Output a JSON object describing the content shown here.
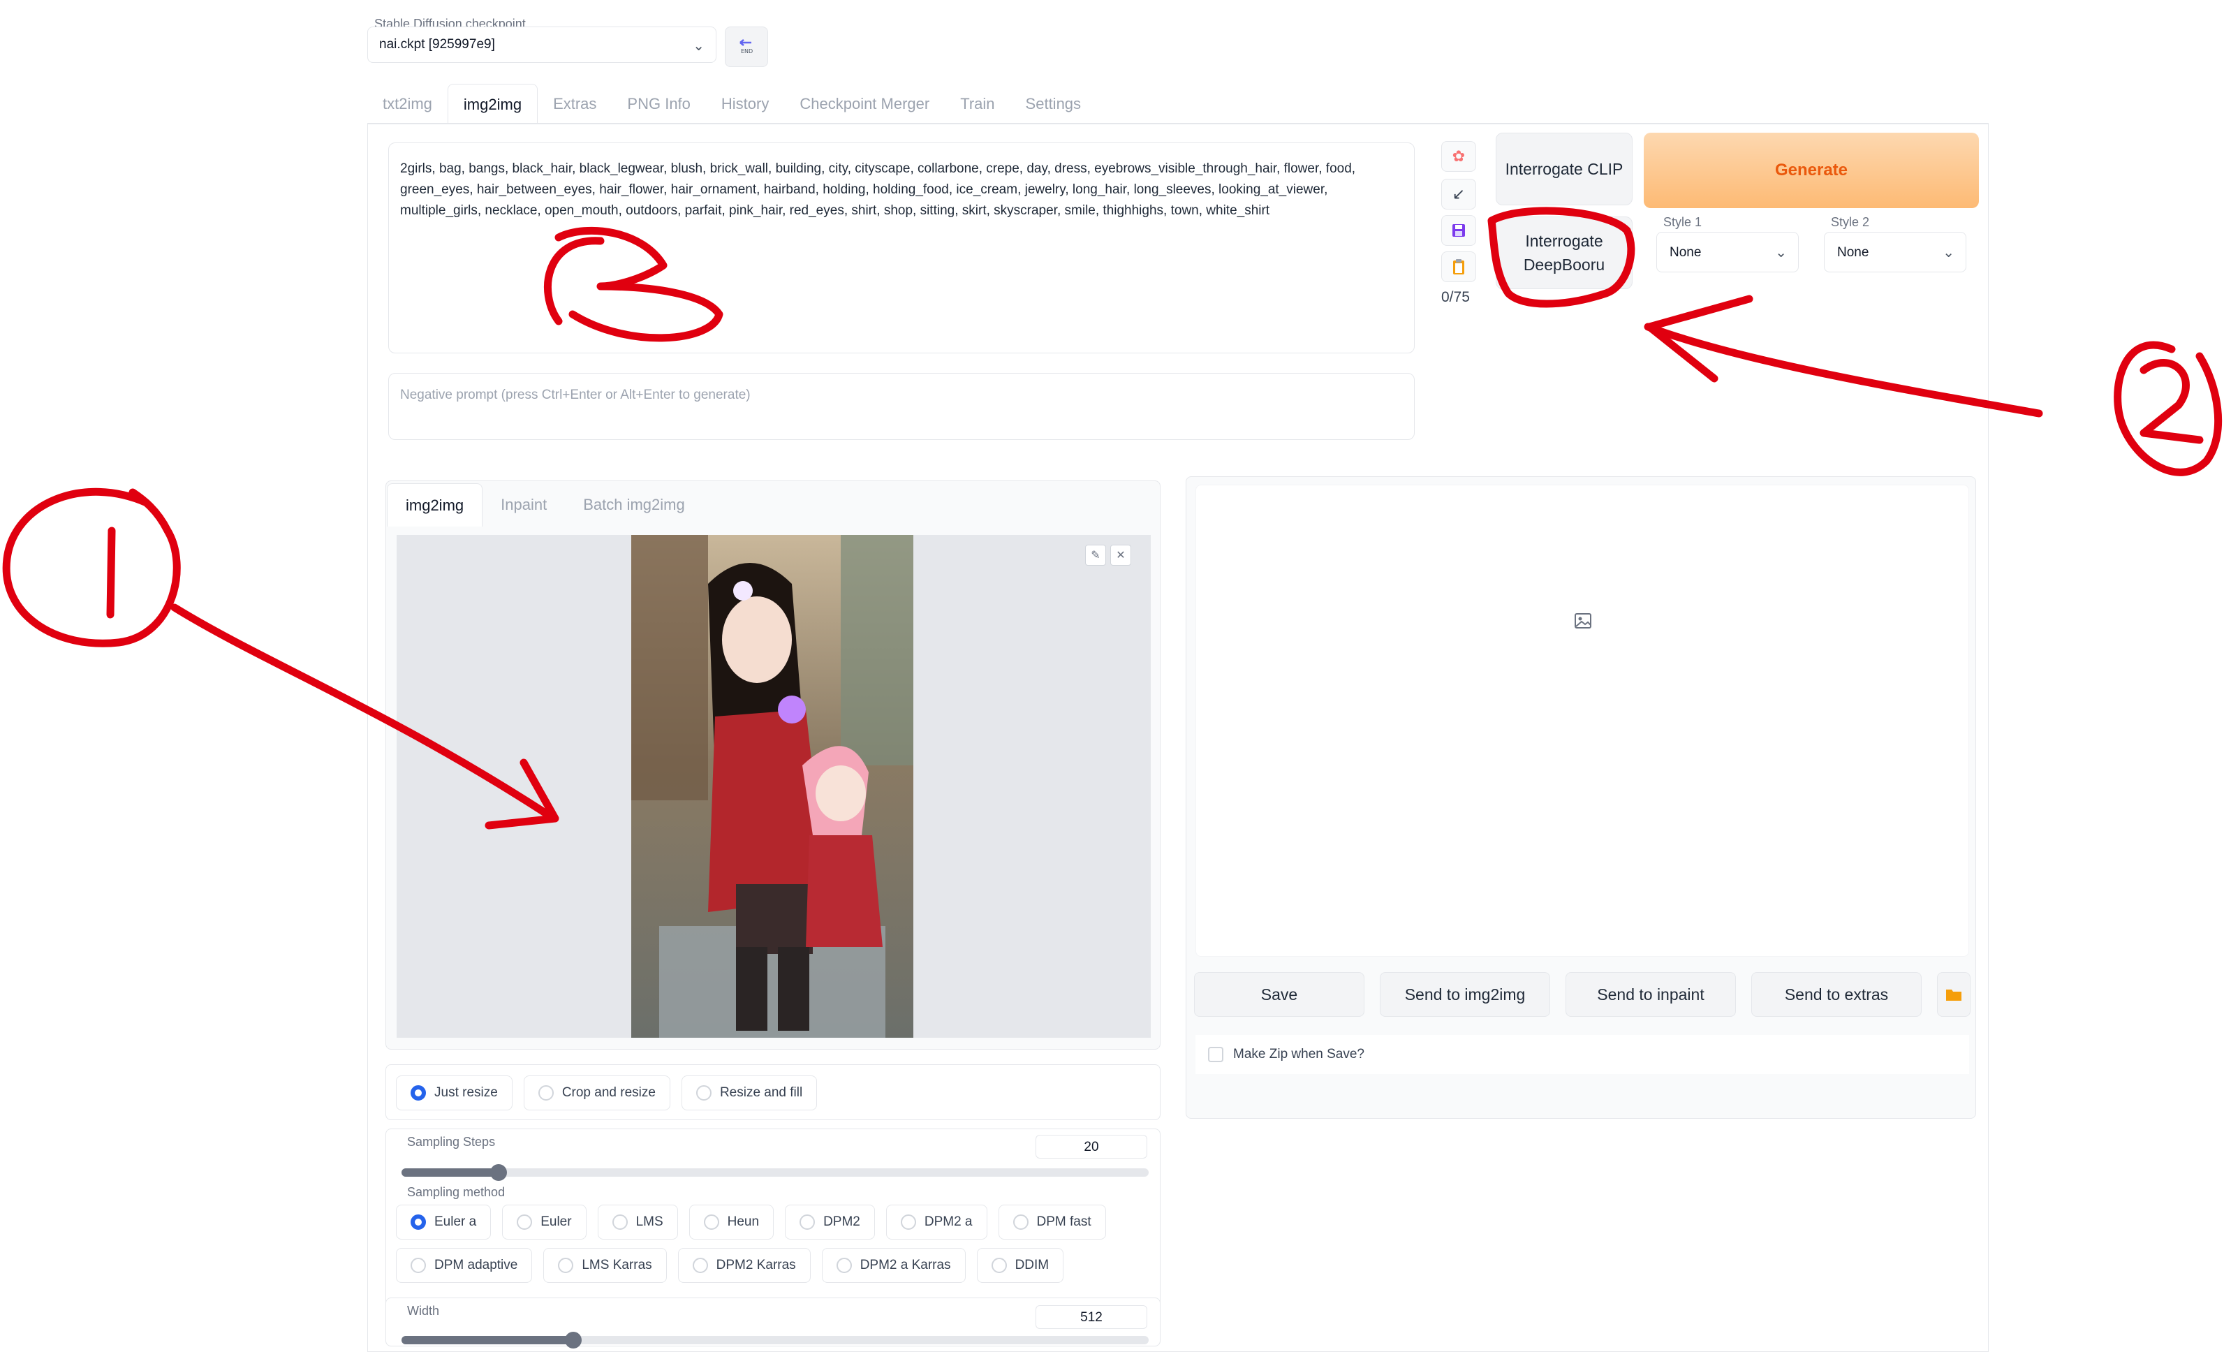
{
  "checkpoint": {
    "label": "Stable Diffusion checkpoint",
    "value": "nai.ckpt [925997e9]"
  },
  "tabs": [
    "txt2img",
    "img2img",
    "Extras",
    "PNG Info",
    "History",
    "Checkpoint Merger",
    "Train",
    "Settings"
  ],
  "prompt": {
    "text": "2girls, bag, bangs, black_hair, black_legwear, blush, brick_wall, building, city, cityscape, collarbone, crepe, day, dress, eyebrows_visible_through_hair, flower, food, green_eyes, hair_between_eyes, hair_flower, hair_ornament, hairband, holding, holding_food, ice_cream, jewelry, long_hair, long_sleeves, looking_at_viewer, multiple_girls, necklace, open_mouth, outdoors, parfait, pink_hair, red_eyes, shirt, shop, sitting, skirt, skyscraper, smile, thighhighs, town, white_shirt"
  },
  "negative_prompt": {
    "placeholder": "Negative prompt (press Ctrl+Enter or Alt+Enter to generate)"
  },
  "token_count": "0/75",
  "buttons": {
    "interrogate_clip": "Interrogate CLIP",
    "interrogate_deepbooru": "Interrogate DeepBooru",
    "generate": "Generate"
  },
  "styles": {
    "style1_label": "Style 1",
    "style1_value": "None",
    "style2_label": "Style 2",
    "style2_value": "None"
  },
  "subtabs": [
    "img2img",
    "Inpaint",
    "Batch img2img"
  ],
  "resize_modes": {
    "options": [
      "Just resize",
      "Crop and resize",
      "Resize and fill"
    ],
    "selected": "Just resize"
  },
  "sampling_steps": {
    "label": "Sampling Steps",
    "value": "20",
    "fraction": 0.13
  },
  "sampling_method": {
    "label": "Sampling method",
    "row1": [
      "Euler a",
      "Euler",
      "LMS",
      "Heun",
      "DPM2",
      "DPM2 a",
      "DPM fast"
    ],
    "row2": [
      "DPM adaptive",
      "LMS Karras",
      "DPM2 Karras",
      "DPM2 a Karras",
      "DDIM"
    ],
    "selected": "Euler a"
  },
  "width": {
    "label": "Width",
    "value": "512",
    "fraction": 0.23
  },
  "output_buttons": {
    "save": "Save",
    "send_img2img": "Send to img2img",
    "send_inpaint": "Send to inpaint",
    "send_extras": "Send to extras"
  },
  "make_zip": "Make Zip when Save?",
  "colors": {
    "annotation": "#e0000f",
    "accent": "#ea580c",
    "radio": "#2563eb"
  }
}
